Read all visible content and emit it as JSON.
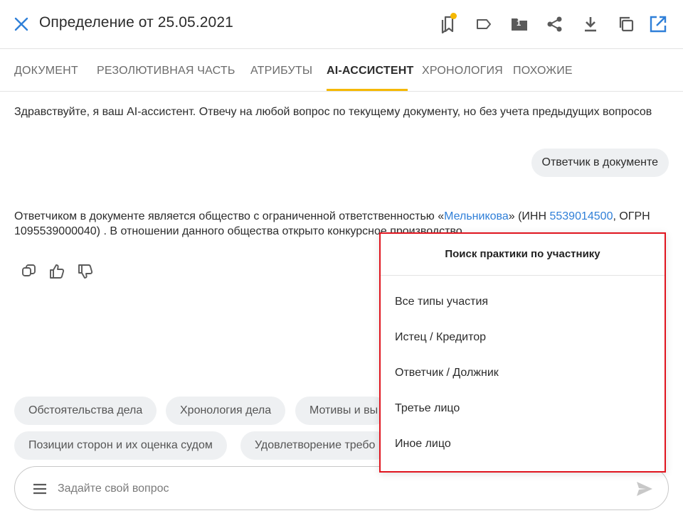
{
  "header": {
    "title": "Определение от 25.05.2021",
    "folder_count": "1",
    "accent_color": "#2f7fd8",
    "badge_color": "#f5b800"
  },
  "tabs": [
    {
      "label": "Документ"
    },
    {
      "label": "Резолютивная часть"
    },
    {
      "label": "Атрибуты"
    },
    {
      "label": "AI-ассистент",
      "active": true
    },
    {
      "label": "Хронология"
    },
    {
      "label": "Похожие"
    }
  ],
  "chat": {
    "greeting": "Здравствуйте, я ваш AI-ассистент. Отвечу на любой вопрос по текущему документу, но без учета предыдущих вопросов",
    "user_message": "Ответчик в документе",
    "answer": {
      "part1": "Ответчиком в документе является общество с ограниченной ответственностью «",
      "link_name": "Мельникова",
      "part2": "» (ИНН ",
      "link_inn": "5539014500",
      "part3": ", ОГРН 1095539000040) . В отношении данного общества открыто конкурсное производство."
    }
  },
  "chips": {
    "row1": [
      "Обстоятельства дела",
      "Хронология дела",
      "Мотивы и вы"
    ],
    "row2": [
      "Позиции сторон и их оценка судом",
      "Удовлетворение требо"
    ]
  },
  "input": {
    "placeholder": "Задайте свой вопрос",
    "value": ""
  },
  "popup": {
    "title": "Поиск практики по участнику",
    "items": [
      "Все типы участия",
      "Истец / Кредитор",
      "Ответчик / Должник",
      "Третье лицо",
      "Иное лицо"
    ],
    "border_color": "#e0141e"
  }
}
